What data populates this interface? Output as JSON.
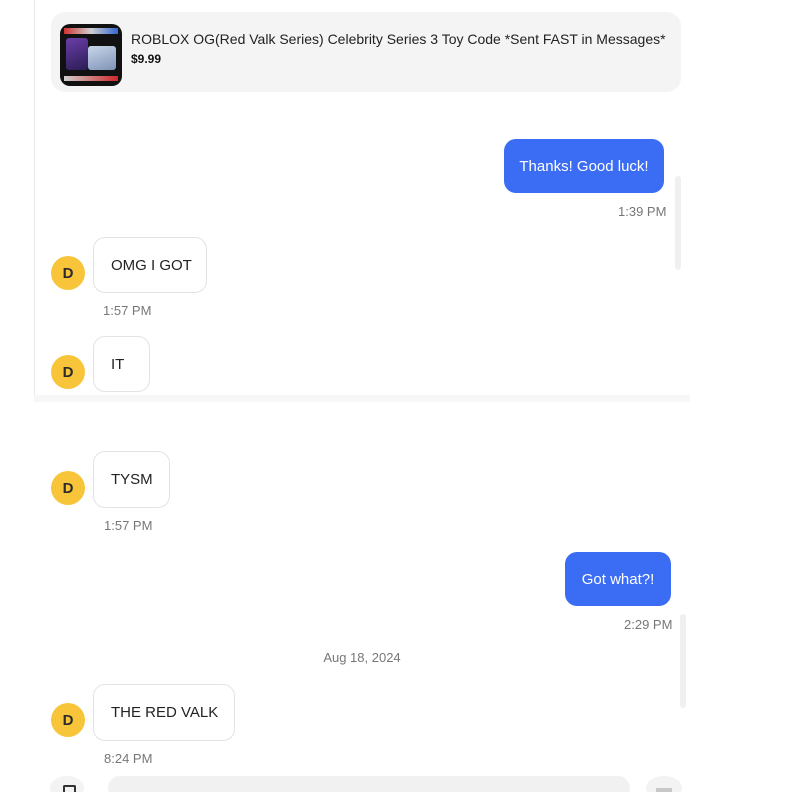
{
  "listing": {
    "title": "ROBLOX OG(Red Valk Series) Celebrity Series 3 Toy Code *Sent FAST in Messages*",
    "price": "$9.99"
  },
  "avatar_initial": "D",
  "messages_top": [
    {
      "text": "Thanks! Good luck!",
      "time": "1:39 PM",
      "direction": "outgoing"
    },
    {
      "text": "OMG I GOT",
      "time": "1:57 PM",
      "direction": "incoming"
    },
    {
      "text": "IT",
      "direction": "incoming"
    }
  ],
  "messages_bottom": [
    {
      "text": "TYSM",
      "time": "1:57 PM",
      "direction": "incoming"
    },
    {
      "text": "Got what?!",
      "time": "2:29 PM",
      "direction": "outgoing"
    }
  ],
  "date_separator": "Aug 18, 2024",
  "messages_after_date": [
    {
      "text": "THE RED VALK",
      "time": "8:24 PM",
      "direction": "incoming"
    }
  ],
  "colors": {
    "outgoing_bubble": "#3b6cf4",
    "avatar": "#f8c53a"
  }
}
